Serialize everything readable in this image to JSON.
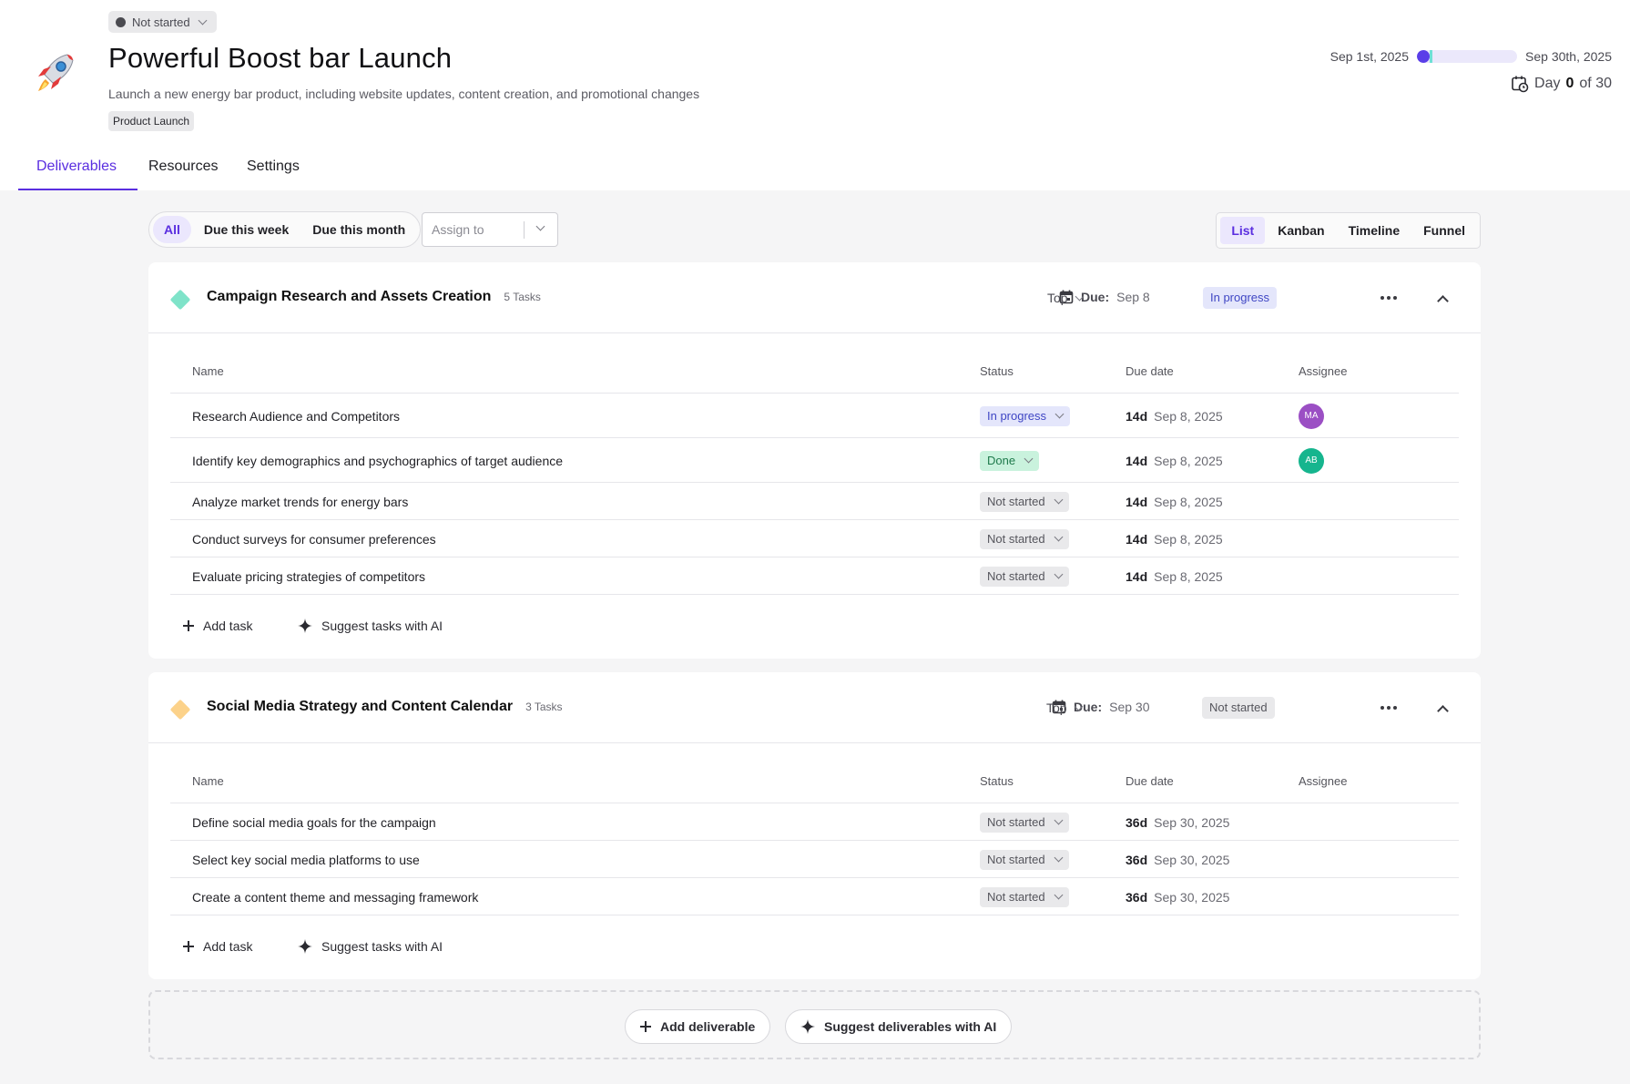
{
  "project": {
    "status_label": "Not started",
    "title": "Powerful Boost bar Launch",
    "description": "Launch a new energy bar product, including website updates, content creation, and promotional changes",
    "tag": "Product Launch",
    "icon": "rocket-icon",
    "start_date": "Sep 1st, 2025",
    "end_date": "Sep 30th, 2025",
    "progress_fraction": 0.0,
    "day_prefix": "Day",
    "day_current": "0",
    "day_suffix": "of 30"
  },
  "tabs": [
    {
      "label": "Deliverables",
      "active": true
    },
    {
      "label": "Resources",
      "active": false
    },
    {
      "label": "Settings",
      "active": false
    }
  ],
  "filters": {
    "items": [
      "All",
      "Due this week",
      "Due this month"
    ],
    "active": "All",
    "assign_placeholder": "Assign to"
  },
  "views": {
    "items": [
      "List",
      "Kanban",
      "Timeline",
      "Funnel"
    ],
    "active": "List"
  },
  "table_headers": {
    "name": "Name",
    "status": "Status",
    "due_date": "Due date",
    "assignee": "Assignee"
  },
  "deliverables": [
    {
      "title": "Campaign Research and Assets Creation",
      "task_count": "5 Tasks",
      "due_label": "Due:",
      "due_value": "Sep 8",
      "priority": "Top",
      "status": "In progress",
      "color": "#7fe3c9",
      "tasks": [
        {
          "name": "Research Audience and Competitors",
          "status": "In progress",
          "days": "14d",
          "date": "Sep 8, 2025",
          "assignee": "MA",
          "assignee_color": "#9b4fc4"
        },
        {
          "name": "Identify key demographics and psychographics of target audience",
          "status": "Done",
          "days": "14d",
          "date": "Sep 8, 2025",
          "assignee": "AB",
          "assignee_color": "#16b58e"
        },
        {
          "name": "Analyze market trends for energy bars",
          "status": "Not started",
          "days": "14d",
          "date": "Sep 8, 2025",
          "assignee": "",
          "assignee_color": ""
        },
        {
          "name": "Conduct surveys for consumer preferences",
          "status": "Not started",
          "days": "14d",
          "date": "Sep 8, 2025",
          "assignee": "",
          "assignee_color": ""
        },
        {
          "name": "Evaluate pricing strategies of competitors",
          "status": "Not started",
          "days": "14d",
          "date": "Sep 8, 2025",
          "assignee": "",
          "assignee_color": ""
        }
      ]
    },
    {
      "title": "Social Media Strategy and Content Calendar",
      "task_count": "3 Tasks",
      "due_label": "Due:",
      "due_value": "Sep 30",
      "priority": "Top",
      "status": "Not started",
      "color": "#fcd28a",
      "tasks": [
        {
          "name": "Define social media goals for the campaign",
          "status": "Not started",
          "days": "36d",
          "date": "Sep 30, 2025",
          "assignee": "",
          "assignee_color": ""
        },
        {
          "name": "Select key social media platforms to use",
          "status": "Not started",
          "days": "36d",
          "date": "Sep 30, 2025",
          "assignee": "",
          "assignee_color": ""
        },
        {
          "name": "Create a content theme and messaging framework",
          "status": "Not started",
          "days": "36d",
          "date": "Sep 30, 2025",
          "assignee": "",
          "assignee_color": ""
        }
      ]
    }
  ],
  "actions": {
    "add_task": "Add task",
    "suggest_tasks": "Suggest tasks with AI",
    "add_deliverable": "Add deliverable",
    "suggest_deliverables": "Suggest deliverables with AI"
  },
  "colors": {
    "accent": "#5a2ee0",
    "in_progress_bg": "#e4e6fb",
    "done_bg": "#c9f2dd",
    "not_started_bg": "#e9e9eb"
  }
}
